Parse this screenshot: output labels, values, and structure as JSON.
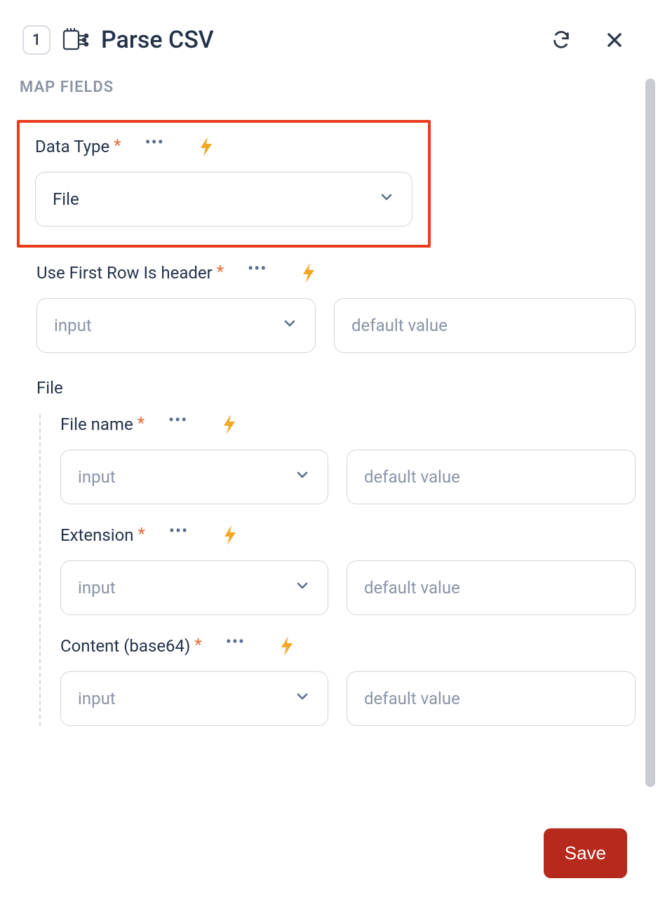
{
  "header": {
    "step": "1",
    "title": "Parse CSV"
  },
  "section_label": "MAP FIELDS",
  "fields": {
    "data_type": {
      "label": "Data Type",
      "value": "File"
    },
    "use_first_row": {
      "label": "Use First Row Is header",
      "select_placeholder": "input",
      "default_placeholder": "default value"
    },
    "file_group": {
      "label": "File",
      "file_name": {
        "label": "File name",
        "select_placeholder": "input",
        "default_placeholder": "default value"
      },
      "extension": {
        "label": "Extension",
        "select_placeholder": "input",
        "default_placeholder": "default value"
      },
      "content": {
        "label": "Content (base64)",
        "select_placeholder": "input",
        "default_placeholder": "default value"
      }
    }
  },
  "footer": {
    "save_label": "Save"
  },
  "colors": {
    "accent": "#b52a1c",
    "highlight": "#eb3b1d",
    "bolt": "#f5a623",
    "asterisk": "#e86a36"
  }
}
